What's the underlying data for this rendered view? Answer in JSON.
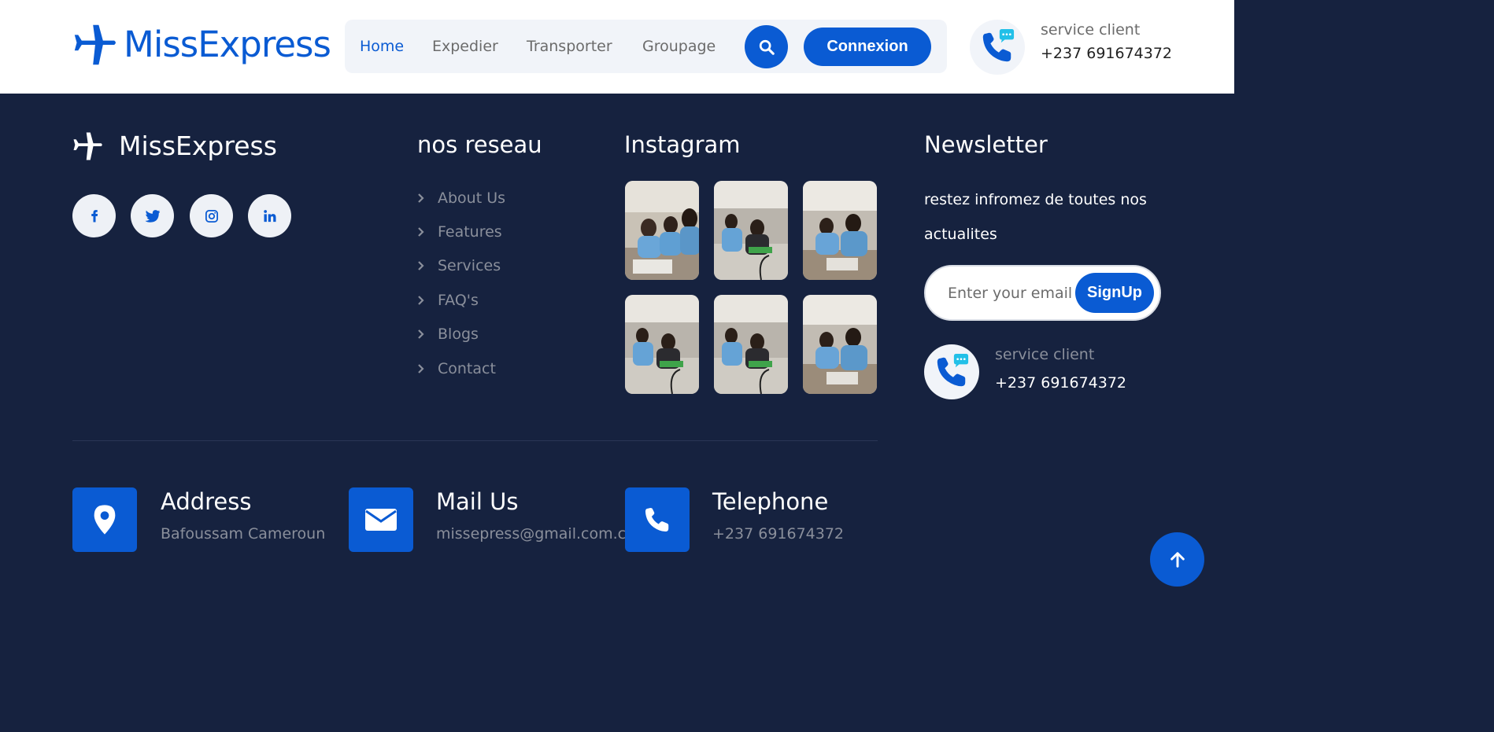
{
  "header": {
    "brand": "MissExpress",
    "nav": [
      {
        "label": "Home",
        "active": true
      },
      {
        "label": "Expedier",
        "active": false
      },
      {
        "label": "Transporter",
        "active": false
      },
      {
        "label": "Groupage",
        "active": false
      }
    ],
    "search_icon": "search-icon",
    "login_label": "Connexion",
    "service_label": "service client",
    "phone": "+237 691674372"
  },
  "footer": {
    "brand": "MissExpress",
    "social": [
      "facebook-icon",
      "twitter-icon",
      "instagram-icon",
      "linkedin-icon"
    ],
    "links_title": "nos reseau",
    "links": [
      "About Us",
      "Features",
      "Services",
      "FAQ's",
      "Blogs",
      "Contact"
    ],
    "instagram_title": "Instagram",
    "instagram_count": 6,
    "newsletter": {
      "title": "Newsletter",
      "text": "restez infromez de toutes nos actualites",
      "placeholder": "Enter your email",
      "button": "SignUp",
      "service_label": "service client",
      "phone": "+237 691674372"
    },
    "contacts": [
      {
        "title": "Address",
        "value": "Bafoussam Cameroun",
        "icon": "location-pin-icon"
      },
      {
        "title": "Mail Us",
        "value": "missepress@gmail.com.cc",
        "icon": "envelope-icon"
      },
      {
        "title": "Telephone",
        "value": "+237 691674372",
        "icon": "phone-icon"
      }
    ]
  },
  "colors": {
    "brand": "#0a5bd3",
    "footer_bg": "#16223f",
    "muted_text": "#8a8f9b"
  }
}
